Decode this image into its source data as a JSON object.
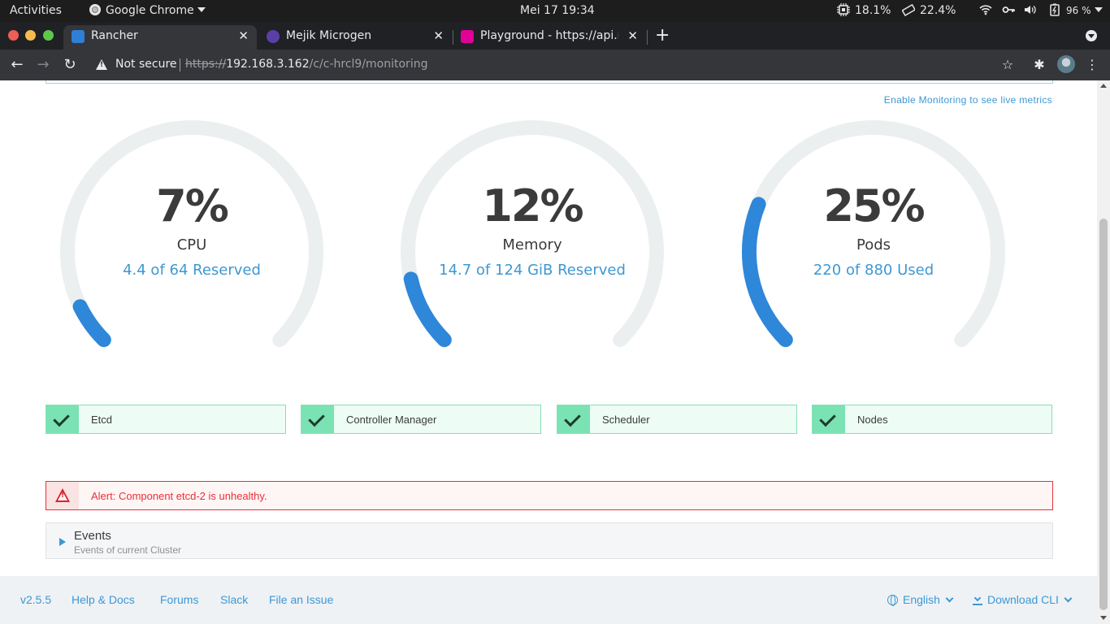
{
  "os_bar": {
    "activities": "Activities",
    "app_name": "Google Chrome",
    "clock": "Mei 17  19:34",
    "cpu": "18.1%",
    "memory": "22.4%",
    "battery": "96 %"
  },
  "browser": {
    "tabs": [
      {
        "title": "Rancher",
        "favicon_color": "#2f7fd6",
        "active": true
      },
      {
        "title": "Mejik Microgen",
        "favicon_color": "#5b3fa8",
        "active": false
      },
      {
        "title": "Playground - https://api.m",
        "favicon_color": "#e10098",
        "active": false
      }
    ],
    "security_label": "Not secure",
    "url_scheme": "https://",
    "url_host": "192.168.3.162",
    "url_path": "/c/c-hrcl9/monitoring"
  },
  "page": {
    "enable_monitoring_link": "Enable Monitoring to see live metrics",
    "gauges": [
      {
        "id": "cpu",
        "percent_text": "7%",
        "fraction": 0.07,
        "label": "CPU",
        "detail": "4.4 of 64 Reserved"
      },
      {
        "id": "memory",
        "percent_text": "12%",
        "fraction": 0.12,
        "label": "Memory",
        "detail": "14.7 of 124 GiB Reserved"
      },
      {
        "id": "pods",
        "percent_text": "25%",
        "fraction": 0.25,
        "label": "Pods",
        "detail": "220 of 880 Used"
      }
    ],
    "components": [
      {
        "label": "Etcd"
      },
      {
        "label": "Controller Manager"
      },
      {
        "label": "Scheduler"
      },
      {
        "label": "Nodes"
      }
    ],
    "alert": "Alert: Component etcd-2 is unhealthy.",
    "events": {
      "title": "Events",
      "subtitle": "Events of current Cluster"
    }
  },
  "footer": {
    "version": "v2.5.5",
    "help": "Help & Docs",
    "forums": "Forums",
    "slack": "Slack",
    "issue": "File an Issue",
    "language": "English",
    "download": "Download CLI"
  },
  "colors": {
    "accent": "#3d98d3",
    "gauge_track": "#ebeff0",
    "gauge_fill": "#2e87d9",
    "success": "#7ae2b3",
    "error": "#e8303a"
  }
}
